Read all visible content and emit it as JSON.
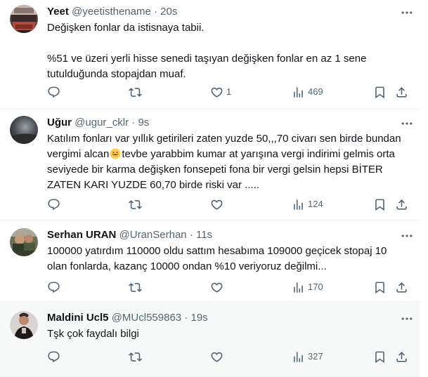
{
  "tweets": [
    {
      "name": "Yeet",
      "handle": "@yeetisthename",
      "dot": "·",
      "time": "20s",
      "lines": [
        "Değişken fonlar da istisnaya tabii.",
        "",
        "%51 ve üzeri yerli hisse senedi taşıyan değişken fonlar en az 1 sene",
        "tutulduğunda stopajdan muaf."
      ],
      "reply_count": "",
      "retweet_count": "",
      "like_count": "1",
      "view_count": "469"
    },
    {
      "name": "Uğur",
      "handle": "@ugur_cklr",
      "dot": "·",
      "time": "9s",
      "line1": "Katılım fonları var yıllık getirileri zaten yuzde 50,,,70 civarı sen birde bundan",
      "line2_a": "vergimi alcan",
      "line2_b": "tevbe yarabbim kumar at yarışına vergi indirimi gelmis orta",
      "line3": "seviyede bir karma değişken fonsepeti fona bir vergi gelsin hepsi BİTER",
      "line4": "ZATEN KARI YUZDE 60,70 birde riski var .....",
      "emoji": "grinning-face-emoji",
      "reply_count": "",
      "retweet_count": "",
      "like_count": "",
      "view_count": "124"
    },
    {
      "name": "Serhan URAN",
      "handle": "@UranSerhan",
      "dot": "·",
      "time": "11s",
      "lines": [
        "100000 yatırdım 110000 oldu sattım hesabıma 109000 geçicek stopaj 10",
        "olan fonlarda, kazanç 10000 ondan %10 veriyoruz değilmi..."
      ],
      "reply_count": "",
      "retweet_count": "",
      "like_count": "",
      "view_count": "170"
    },
    {
      "name": "Maldini Ucl5",
      "handle": "@MUcl559863",
      "dot": "·",
      "time": "19s",
      "lines": [
        "Tşk çok faydalı bilgi"
      ],
      "reply_count": "",
      "retweet_count": "",
      "like_count": "",
      "view_count": "327"
    }
  ],
  "icons": {
    "reply": "reply-icon",
    "retweet": "retweet-icon",
    "like": "like-icon",
    "views": "views-icon",
    "bookmark": "bookmark-icon",
    "share": "share-icon",
    "more": "more-icon"
  },
  "colors": {
    "text": "#0f1419",
    "muted": "#536471",
    "border": "#eff3f4",
    "highlight_bg": "#f7f9f9"
  }
}
